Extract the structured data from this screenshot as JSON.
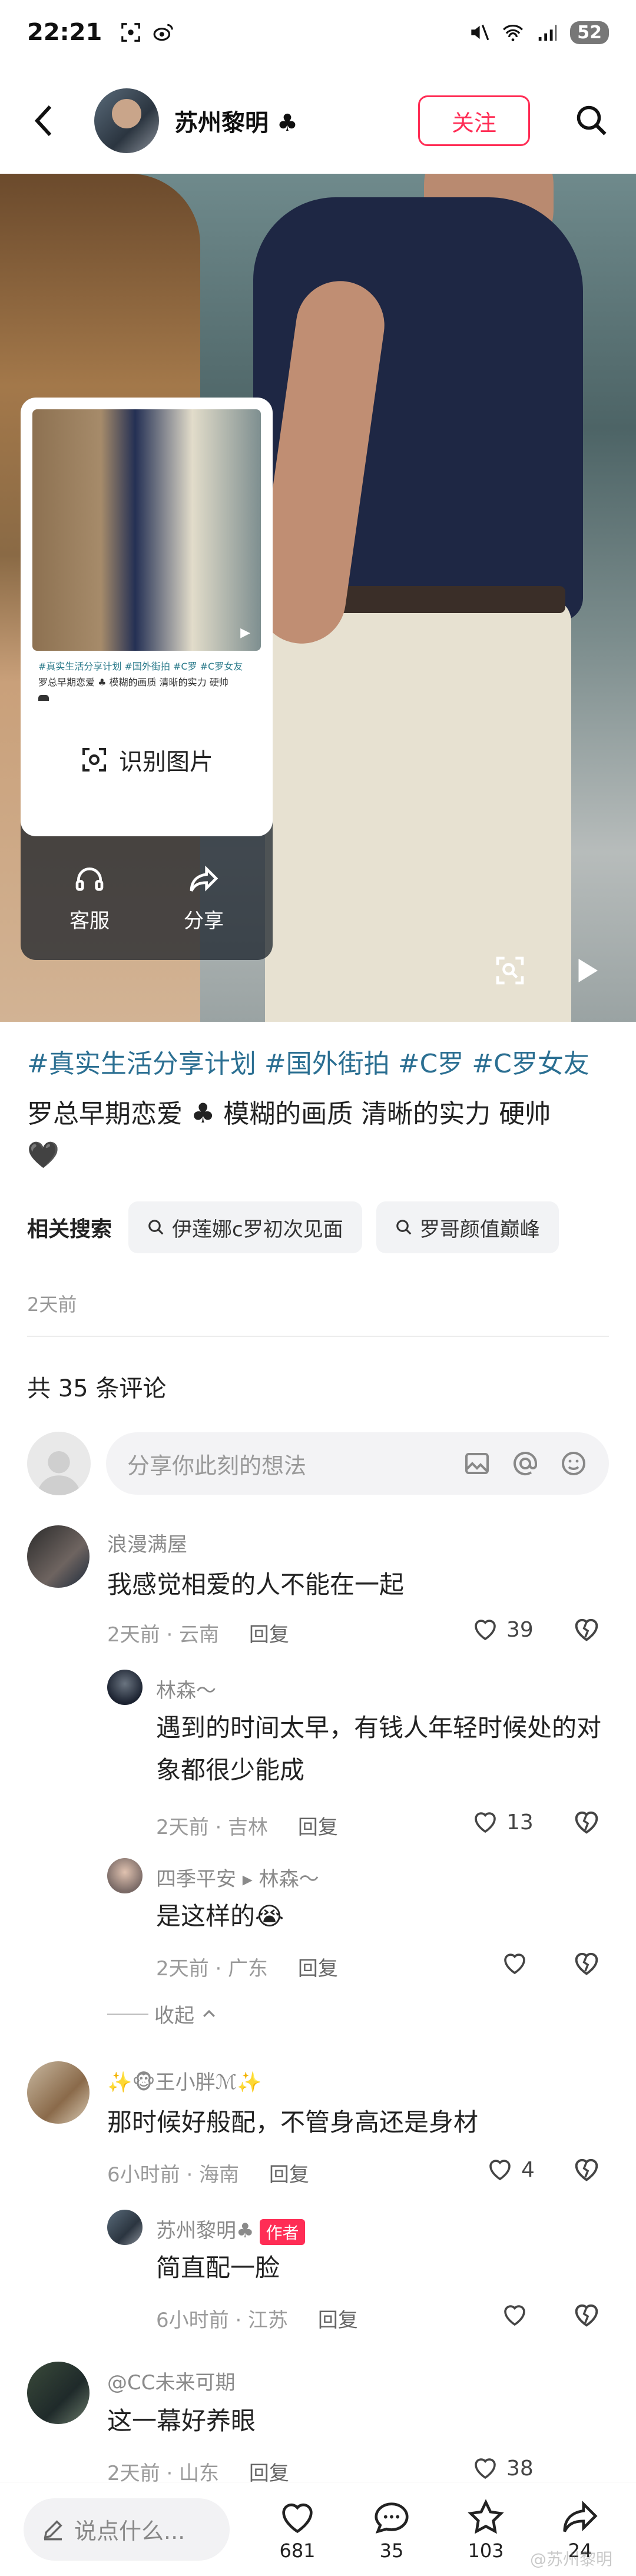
{
  "status_bar": {
    "time": "22:21",
    "battery": "52"
  },
  "header": {
    "username": "苏州黎明",
    "follow_label": "关注"
  },
  "share_panel": {
    "thumb_tags": "#真实生活分享计划 #国外街拍 #C罗 #C罗女友",
    "thumb_desc": "罗总早期恋爱 ♣ 模糊的画质 清晰的实力 硬帅",
    "recognize_label": "识别图片",
    "actions": [
      {
        "label": "客服",
        "icon": "headset-icon"
      },
      {
        "label": "分享",
        "icon": "share-icon"
      }
    ]
  },
  "post": {
    "tags": "#真实生活分享计划 #国外街拍 #C罗 #C罗女友",
    "desc_line1": "罗总早期恋爱",
    "desc_line1b": "模糊的画质 清晰的实力 硬帅",
    "related_label": "相关搜索",
    "related": [
      "伊莲娜c罗初次见面",
      "罗哥颜值巅峰"
    ],
    "time": "2天前",
    "comment_count": "共 35 条评论"
  },
  "composer": {
    "placeholder": "分享你此刻的想法"
  },
  "comments": [
    {
      "name": "浪漫满屋",
      "text": "我感觉相爱的人不能在一起",
      "meta": "2天前 · 云南",
      "reply": "回复",
      "likes": "39"
    },
    {
      "name": "林森～",
      "text": "遇到的时间太早，有钱人年轻时候处的对象都很少能成",
      "meta": "2天前 · 吉林",
      "reply": "回复",
      "likes": "13"
    },
    {
      "name": "四季平安 ▸ 林森～",
      "text": "是这样的😭",
      "meta": "2天前 · 广东",
      "reply": "回复",
      "likes": ""
    },
    {
      "name": "✨🐵王小胖ℳ✨",
      "text": "那时候好般配，不管身高还是身材",
      "meta": "6小时前 · 海南",
      "reply": "回复",
      "likes": "4"
    },
    {
      "name": "苏州黎明♣",
      "badge": "作者",
      "text": "简直配一脸",
      "meta": "6小时前 · 江苏",
      "reply": "回复",
      "likes": ""
    },
    {
      "name": "@CC未来可期",
      "text": "这一幕好养眼",
      "meta": "2天前 · 山东",
      "reply": "回复",
      "likes": "38"
    }
  ],
  "collapse_label": "收起",
  "bottom_bar": {
    "input_placeholder": "说点什么...",
    "likes": "681",
    "comments": "35",
    "stars": "103",
    "shares": "24"
  },
  "watermark": "@苏州黎明"
}
